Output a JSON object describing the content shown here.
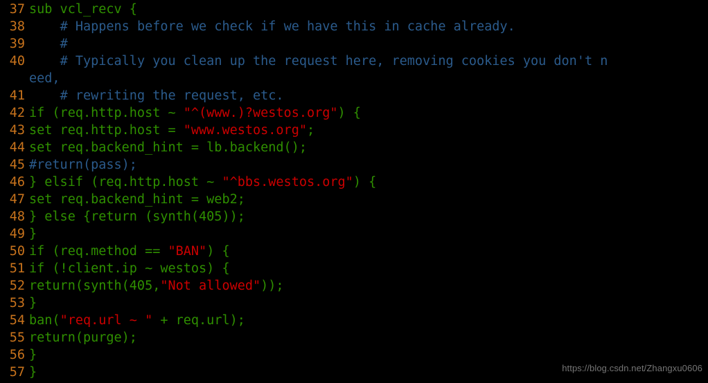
{
  "editor": {
    "language": "vcl",
    "background_color": "#000000",
    "colors": {
      "line_number": "#c8731c",
      "code": "#2f8f00",
      "comment": "#2b5b8c",
      "string": "#cc0000",
      "watermark": "#8a8a8a"
    },
    "first_line_number": 37,
    "last_line_number": 57,
    "lines": [
      {
        "number": "37",
        "wrapped": false,
        "tokens": [
          {
            "type": "code",
            "text": "sub vcl_recv {"
          }
        ]
      },
      {
        "number": "38",
        "wrapped": false,
        "tokens": [
          {
            "type": "code",
            "text": "    "
          },
          {
            "type": "comment",
            "text": "# Happens before we check if we have this in cache already."
          }
        ]
      },
      {
        "number": "39",
        "wrapped": false,
        "tokens": [
          {
            "type": "code",
            "text": "    "
          },
          {
            "type": "comment",
            "text": "#"
          }
        ]
      },
      {
        "number": "40",
        "wrapped": false,
        "tokens": [
          {
            "type": "code",
            "text": "    "
          },
          {
            "type": "comment",
            "text": "# Typically you clean up the request here, removing cookies you don't n"
          }
        ]
      },
      {
        "number": "",
        "wrapped": true,
        "tokens": [
          {
            "type": "comment",
            "text": "eed,"
          }
        ]
      },
      {
        "number": "41",
        "wrapped": false,
        "tokens": [
          {
            "type": "code",
            "text": "    "
          },
          {
            "type": "comment",
            "text": "# rewriting the request, etc."
          }
        ]
      },
      {
        "number": "42",
        "wrapped": false,
        "tokens": [
          {
            "type": "code",
            "text": "if (req.http.host ~ "
          },
          {
            "type": "string",
            "text": "\"^(www.)?westos.org\""
          },
          {
            "type": "code",
            "text": ") {"
          }
        ]
      },
      {
        "number": "43",
        "wrapped": false,
        "tokens": [
          {
            "type": "code",
            "text": "set req.http.host = "
          },
          {
            "type": "string",
            "text": "\"www.westos.org\""
          },
          {
            "type": "code",
            "text": ";"
          }
        ]
      },
      {
        "number": "44",
        "wrapped": false,
        "tokens": [
          {
            "type": "code",
            "text": "set req.backend_hint = lb.backend();"
          }
        ]
      },
      {
        "number": "45",
        "wrapped": false,
        "tokens": [
          {
            "type": "comment",
            "text": "#return(pass);"
          }
        ]
      },
      {
        "number": "46",
        "wrapped": false,
        "tokens": [
          {
            "type": "code",
            "text": "} elsif (req.http.host ~ "
          },
          {
            "type": "string",
            "text": "\"^bbs.westos.org\""
          },
          {
            "type": "code",
            "text": ") {"
          }
        ]
      },
      {
        "number": "47",
        "wrapped": false,
        "tokens": [
          {
            "type": "code",
            "text": "set req.backend_hint = web2;"
          }
        ]
      },
      {
        "number": "48",
        "wrapped": false,
        "tokens": [
          {
            "type": "code",
            "text": "} else {return (synth(405));"
          }
        ]
      },
      {
        "number": "49",
        "wrapped": false,
        "tokens": [
          {
            "type": "code",
            "text": "}"
          }
        ]
      },
      {
        "number": "50",
        "wrapped": false,
        "tokens": [
          {
            "type": "code",
            "text": "if (req.method == "
          },
          {
            "type": "string",
            "text": "\"BAN\""
          },
          {
            "type": "code",
            "text": ") {"
          }
        ]
      },
      {
        "number": "51",
        "wrapped": false,
        "tokens": [
          {
            "type": "code",
            "text": "if (!client.ip ~ westos) {"
          }
        ]
      },
      {
        "number": "52",
        "wrapped": false,
        "tokens": [
          {
            "type": "code",
            "text": "return(synth(405,"
          },
          {
            "type": "string",
            "text": "\"Not allowed\""
          },
          {
            "type": "code",
            "text": "));"
          }
        ]
      },
      {
        "number": "53",
        "wrapped": false,
        "tokens": [
          {
            "type": "code",
            "text": "}"
          }
        ]
      },
      {
        "number": "54",
        "wrapped": false,
        "tokens": [
          {
            "type": "code",
            "text": "ban("
          },
          {
            "type": "string",
            "text": "\"req.url ~ \""
          },
          {
            "type": "code",
            "text": " + req.url);"
          }
        ]
      },
      {
        "number": "55",
        "wrapped": false,
        "tokens": [
          {
            "type": "code",
            "text": "return(purge);"
          }
        ]
      },
      {
        "number": "56",
        "wrapped": false,
        "tokens": [
          {
            "type": "code",
            "text": "}"
          }
        ]
      },
      {
        "number": "57",
        "wrapped": false,
        "tokens": [
          {
            "type": "code",
            "text": "}"
          }
        ]
      }
    ]
  },
  "watermark": {
    "text": "https://blog.csdn.net/Zhangxu0606"
  }
}
